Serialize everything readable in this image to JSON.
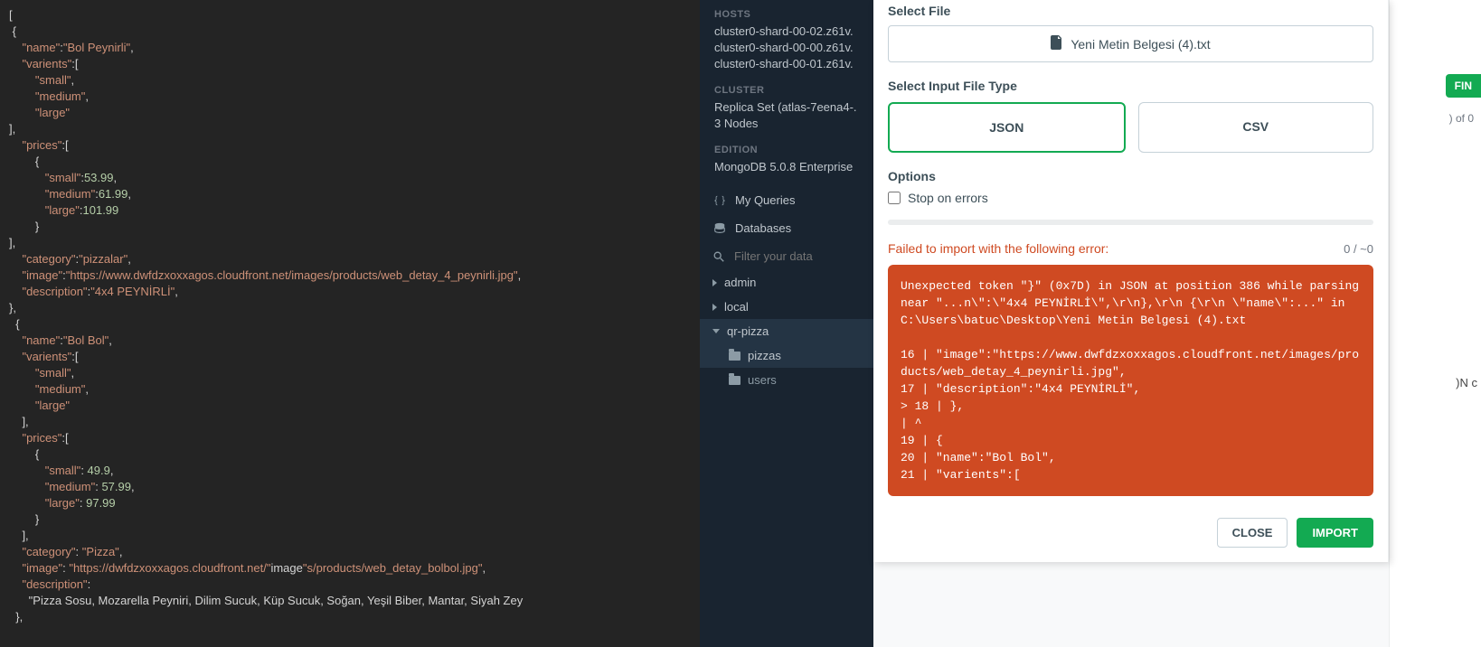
{
  "editor": {
    "code": "[\n {\n    \"name\":\"Bol Peynirli\",\n    \"varients\":[\n        \"small\",\n        \"medium\",\n        \"large\"\n],\n    \"prices\":[\n        {\n           \"small\":53.99,\n           \"medium\":61.99,\n           \"large\":101.99\n        }\n],\n    \"category\":\"pizzalar\",\n    \"image\":\"https://www.dwfdzxoxxagos.cloudfront.net/images/products/web_detay_4_peynirli.jpg\",\n    \"description\":\"4x4 PEYNİRLİ\",\n},\n  {\n    \"name\":\"Bol Bol\",\n    \"varients\":[\n        \"small\",\n        \"medium\",\n        \"large\"\n    ],\n    \"prices\":[\n        {\n           \"small\": 49.9,\n           \"medium\": 57.99,\n           \"large\": 97.99\n        }\n    ],\n    \"category\": \"Pizza\",\n    \"image\": \"https://dwfdzxoxxagos.cloudfront.net/\"image\"s/products/web_detay_bolbol.jpg\",\n    \"description\":\n      \"Pizza Sosu, Mozarella Peyniri, Dilim Sucuk, Küp Sucuk, Soğan, Yeşil Biber, Mantar, Siyah Zey\n  },"
  },
  "sidebar": {
    "hosts_label": "HOSTS",
    "hosts": [
      "cluster0-shard-00-02.z61v.",
      "cluster0-shard-00-00.z61v.",
      "cluster0-shard-00-01.z61v."
    ],
    "cluster_label": "CLUSTER",
    "cluster_value": "Replica Set (atlas-7eena4-.\n3 Nodes",
    "edition_label": "EDITION",
    "edition_value": "MongoDB 5.0.8 Enterprise",
    "my_queries": "My Queries",
    "databases": "Databases",
    "filter_placeholder": "Filter your data",
    "db_admin": "admin",
    "db_local": "local",
    "db_qrpizza": "qr-pizza",
    "coll_pizzas": "pizzas",
    "coll_users": "users"
  },
  "rightstrip": {
    "fin": "FIN",
    "count": ") of 0",
    "jsonc": ")N c"
  },
  "modal": {
    "select_file_label": "Select File",
    "file_name": "Yeni Metin Belgesi (4).txt",
    "select_type_label": "Select Input File Type",
    "type_json": "JSON",
    "type_csv": "CSV",
    "options_label": "Options",
    "stop_on_errors": "Stop on errors",
    "error_message": "Failed to import with the following error:",
    "error_count": "0 / ~0",
    "error_body": "Unexpected token \"}\" (0x7D) in JSON at position 386 while parsing near \"...n\\\":\\\"4x4 PEYNİRLİ\\\",\\r\\n},\\r\\n {\\r\\n \\\"name\\\":...\" in C:\\Users\\batuc\\Desktop\\Yeni Metin Belgesi (4).txt\n\n16 | \"image\":\"https://www.dwfdzxoxxagos.cloudfront.net/images/products/web_detay_4_peynirli.jpg\",\n17 | \"description\":\"4x4 PEYNİRLİ\",\n> 18 | },\n| ^\n19 | {\n20 | \"name\":\"Bol Bol\",\n21 | \"varients\":[",
    "close": "CLOSE",
    "import": "IMPORT"
  }
}
